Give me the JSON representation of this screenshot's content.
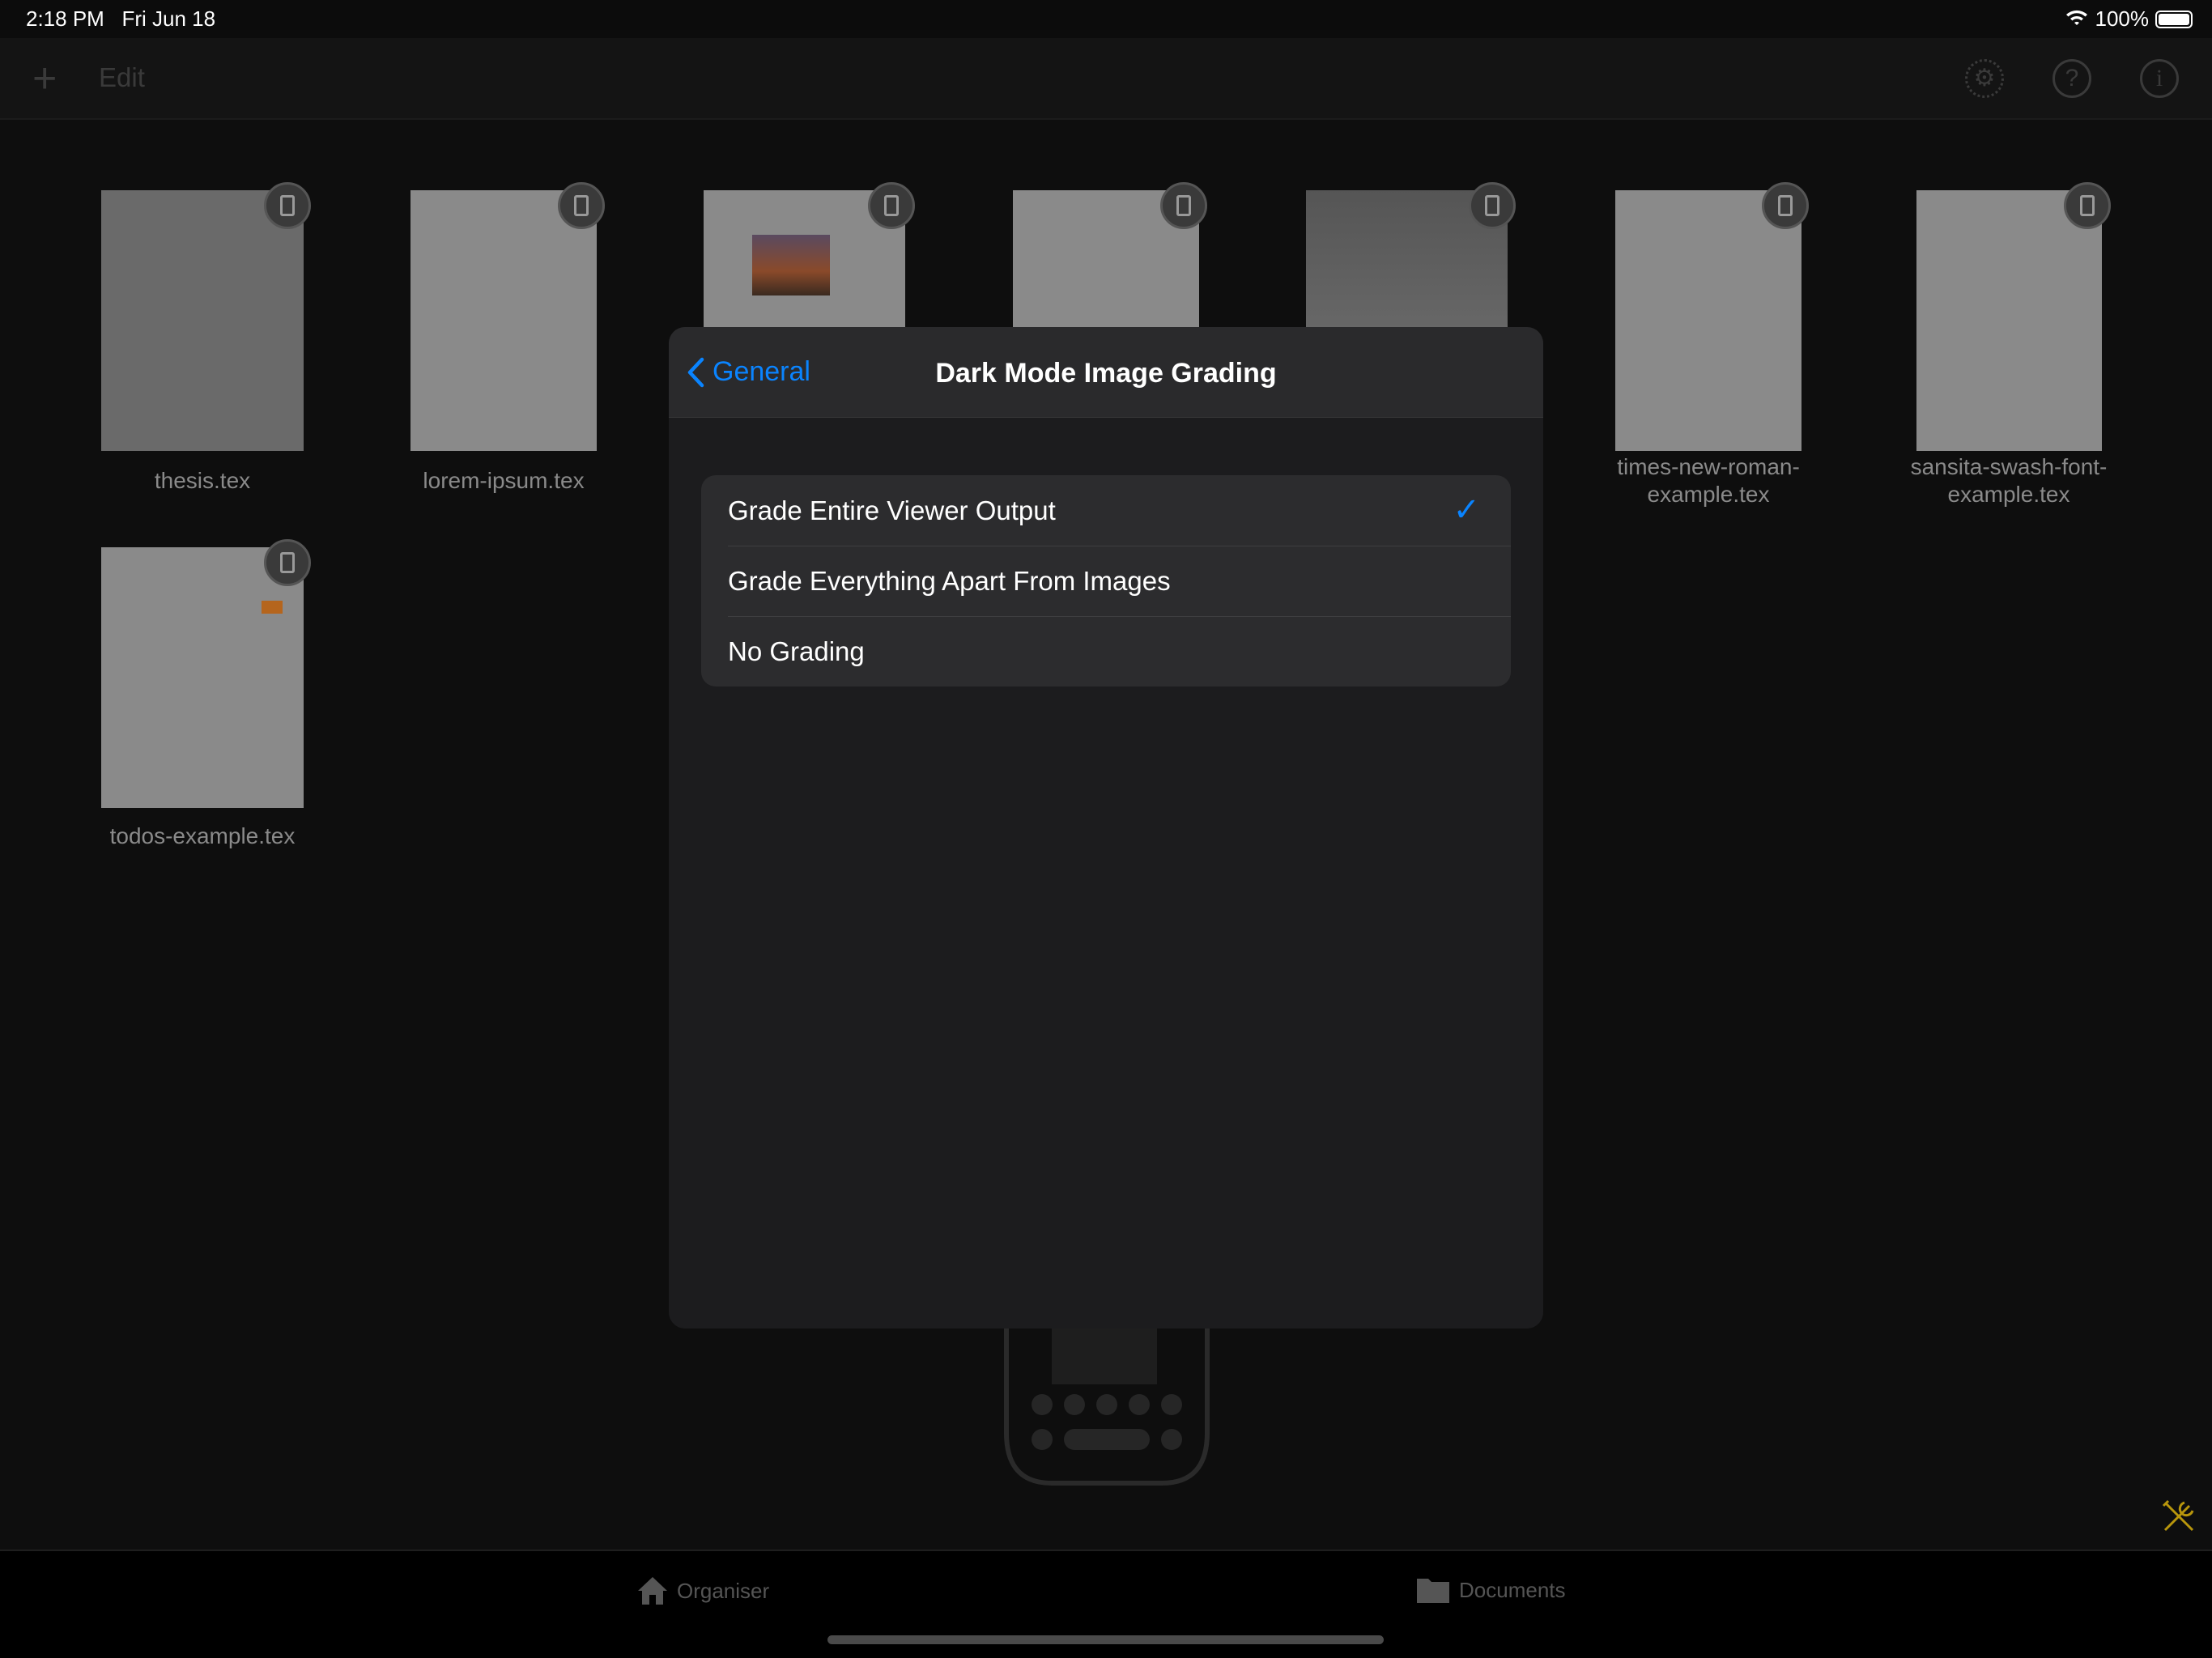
{
  "status_bar": {
    "time": "2:18 PM",
    "date": "Fri Jun 18",
    "battery": "100%",
    "battery_level": 1.0
  },
  "toolbar": {
    "add_icon": "plus-icon",
    "edit_label": "Edit",
    "icons": [
      "gear-icon",
      "help-icon",
      "info-icon"
    ]
  },
  "documents": [
    {
      "name": "thesis.tex"
    },
    {
      "name": "lorem-ipsum.tex"
    },
    {
      "name": ""
    },
    {
      "name": ""
    },
    {
      "name": ""
    },
    {
      "name": "times-new-roman-\nexample.tex"
    },
    {
      "name": "sansita-swash-font-\nexample.tex"
    },
    {
      "name": "todos-example.tex"
    }
  ],
  "modal": {
    "back_label": "General",
    "title": "Dark Mode Image Grading",
    "options": [
      {
        "label": "Grade Entire Viewer Output",
        "selected": true
      },
      {
        "label": "Grade Everything Apart From Images",
        "selected": false
      },
      {
        "label": "No Grading",
        "selected": false
      }
    ],
    "accent": "#0a84ff"
  },
  "tabbar": {
    "organiser": "Organiser",
    "documents": "Documents"
  },
  "tools_icon_color": "#b8960c"
}
